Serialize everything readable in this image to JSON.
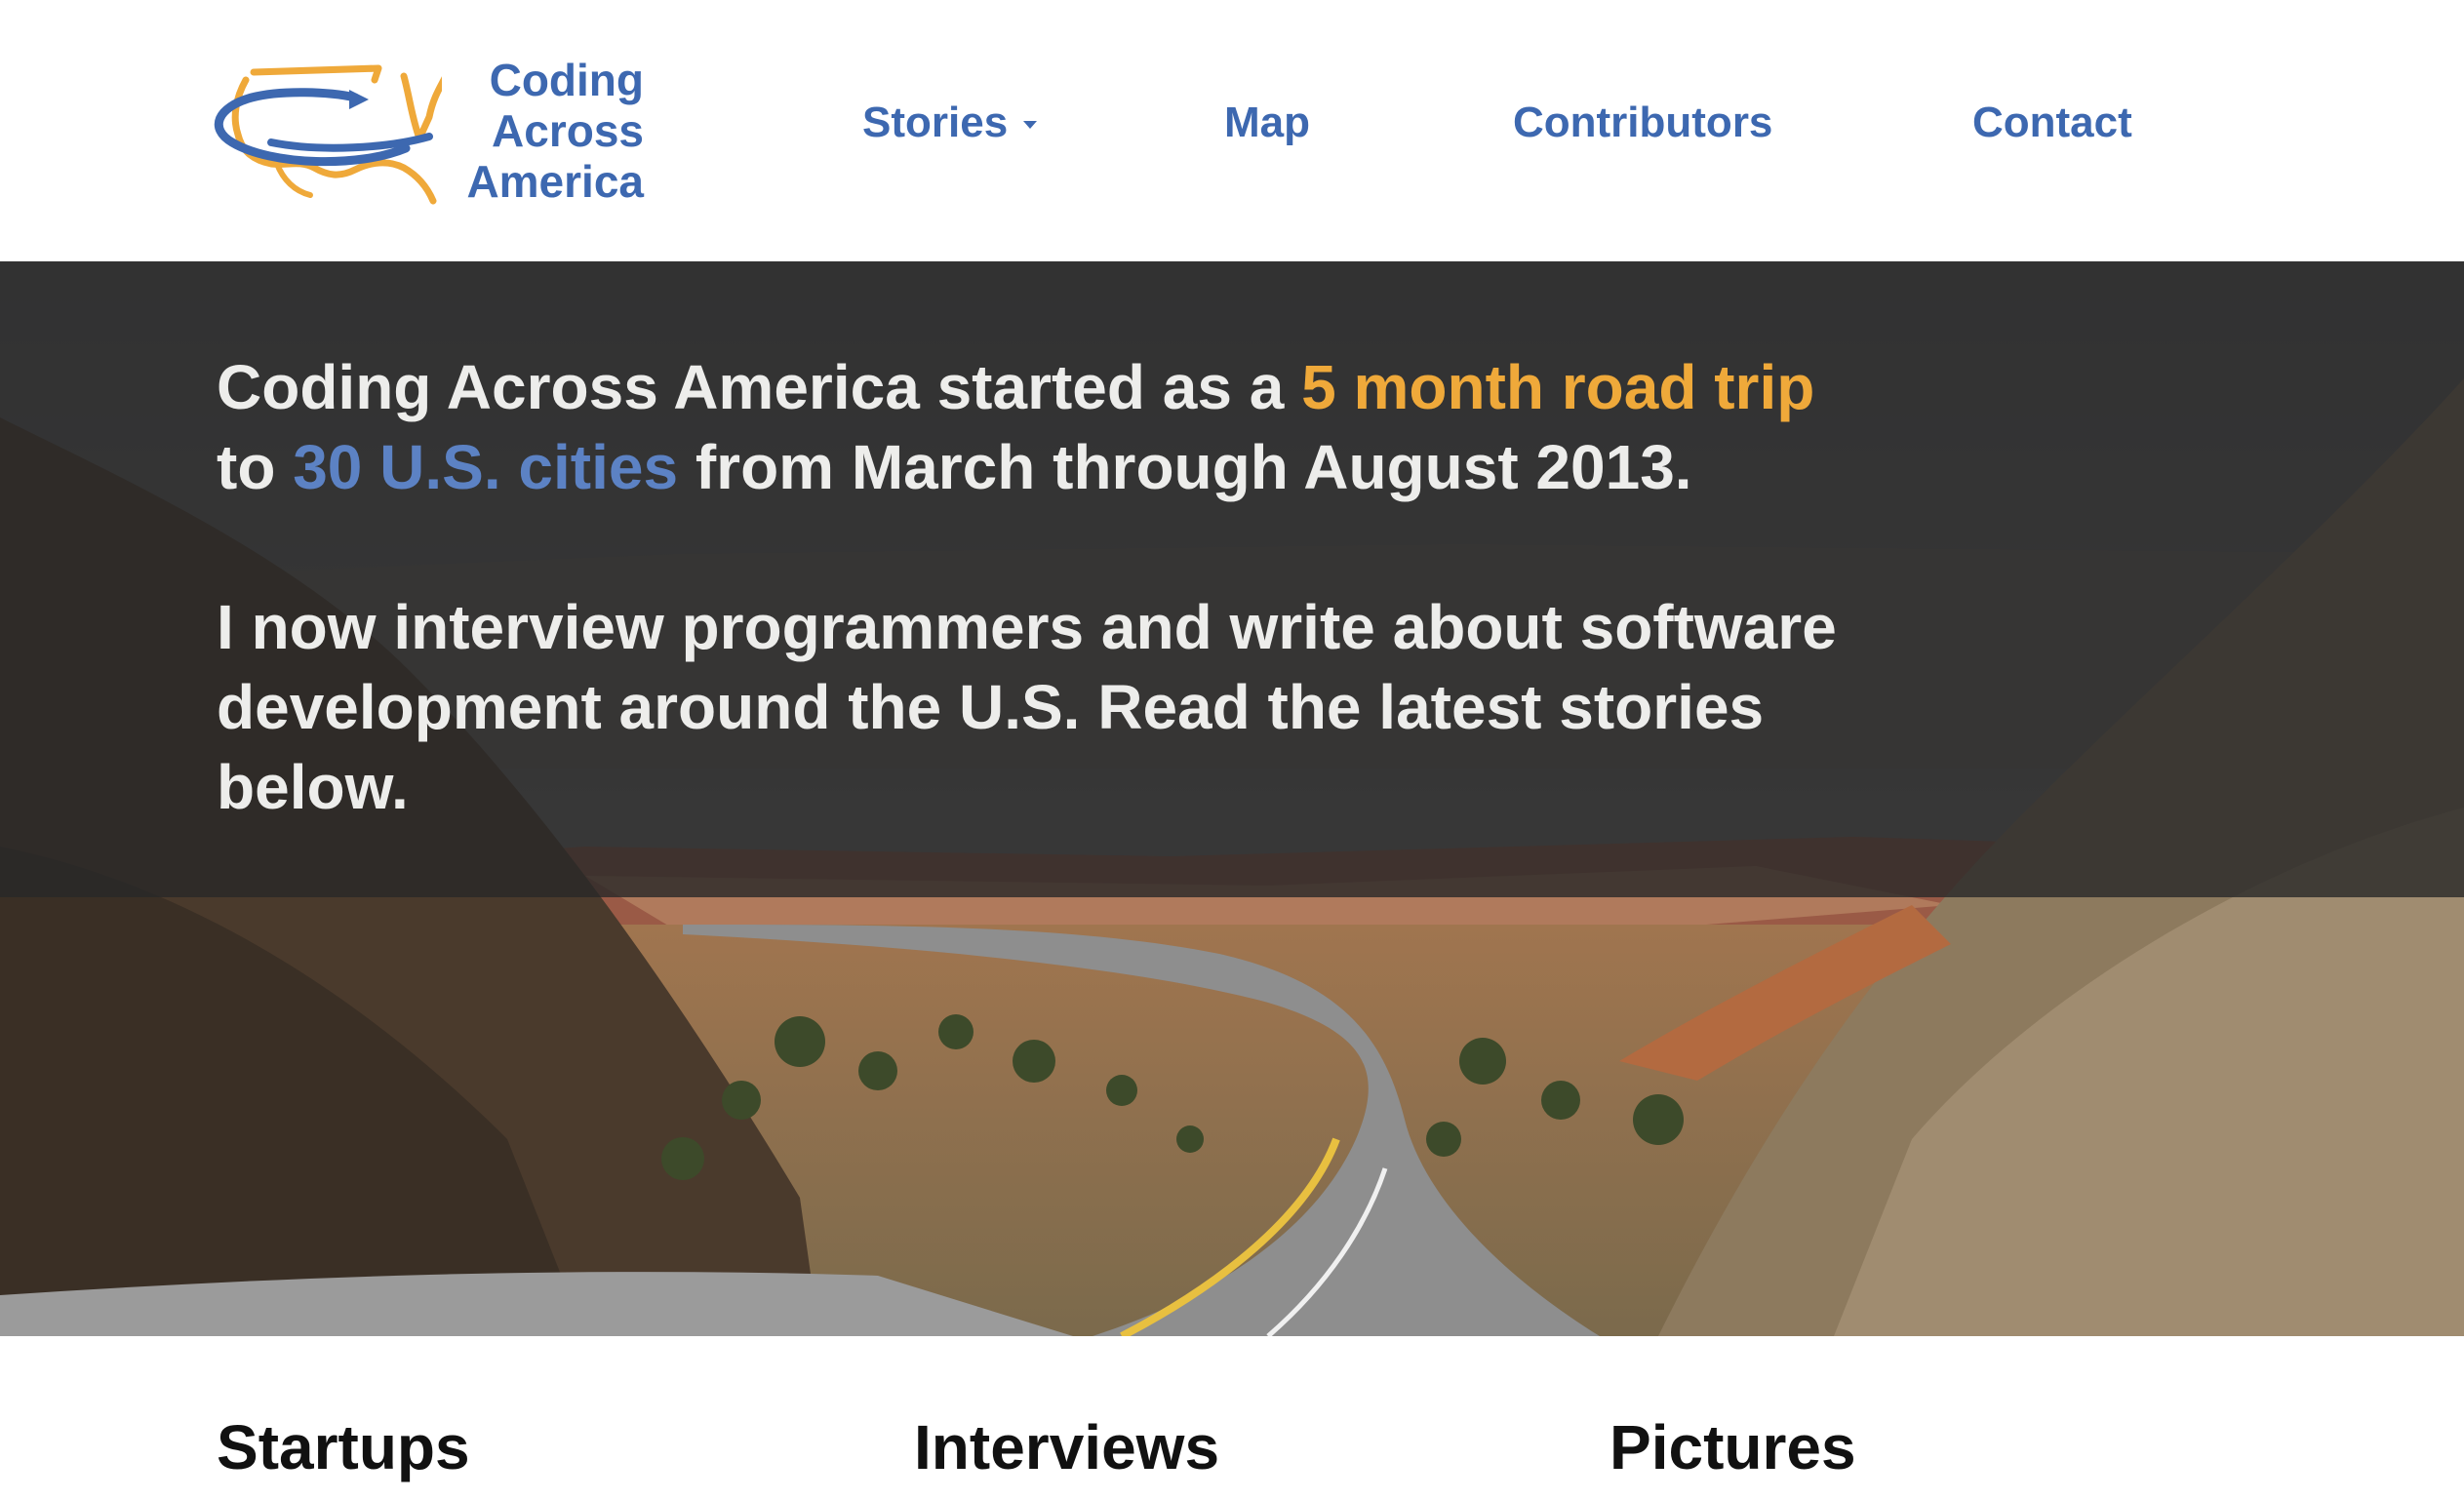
{
  "brand": {
    "name_lines": [
      "Coding",
      "Across",
      "America"
    ],
    "colors": {
      "blue": "#3d68b0",
      "orange": "#efa93a",
      "light_blue": "#5c82c4"
    },
    "logo_icon": "usa-map-loop-icon"
  },
  "nav": {
    "items": [
      {
        "label": "Stories",
        "has_dropdown": true,
        "icon": "caret-down-icon"
      },
      {
        "label": "Map"
      },
      {
        "label": "Contributors"
      },
      {
        "label": "Contact"
      }
    ]
  },
  "hero": {
    "line1": {
      "pre": "Coding Across America started as a ",
      "highlight1": "5 month road trip",
      "mid": " to ",
      "highlight2": "30 U.S. cities",
      "post": " from March through August 2013."
    },
    "paragraph2": "I now interview programmers and write about software development around the U.S. Read the latest stories below."
  },
  "sections": [
    {
      "title": "Startups"
    },
    {
      "title": "Interviews"
    },
    {
      "title": "Pictures"
    }
  ]
}
